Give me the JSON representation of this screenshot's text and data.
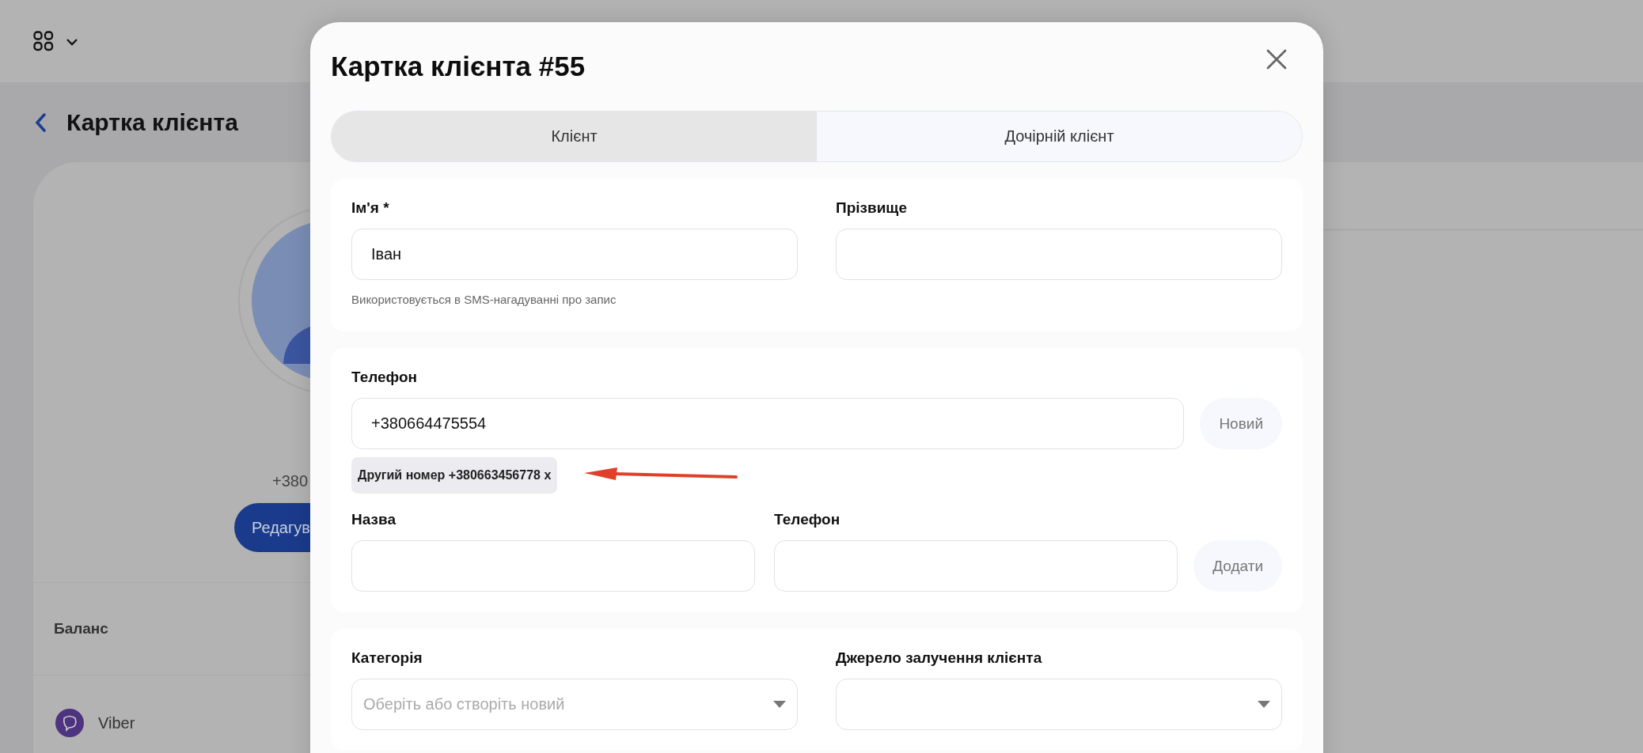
{
  "background": {
    "page_title": "Картка клієнта",
    "phone": "+380",
    "edit_button": "Редагув",
    "balance_label": "Баланс",
    "messenger": "Viber"
  },
  "modal": {
    "title": "Картка клієнта #55",
    "tabs": [
      {
        "label": "Клієнт",
        "selected": true
      },
      {
        "label": "Дочірній клієнт",
        "selected": false
      }
    ],
    "name_section": {
      "first_name": {
        "label": "Ім'я *",
        "value": "Іван",
        "hint": "Використовується в SMS-нагадуванні про запис"
      },
      "last_name": {
        "label": "Прізвище"
      }
    },
    "phone_section": {
      "label": "Телефон",
      "value": "+380664475554",
      "new_button": "Новий",
      "extra_numbers": [
        "Другий номер +380663456778 x"
      ],
      "contact_name_label": "Назва",
      "contact_phone_label": "Телефон",
      "add_button": "Додати"
    },
    "classification_section": {
      "category": {
        "label": "Категорія",
        "placeholder": "Оберіть або створіть новий"
      },
      "source": {
        "label": "Джерело залучення клієнта"
      }
    }
  }
}
